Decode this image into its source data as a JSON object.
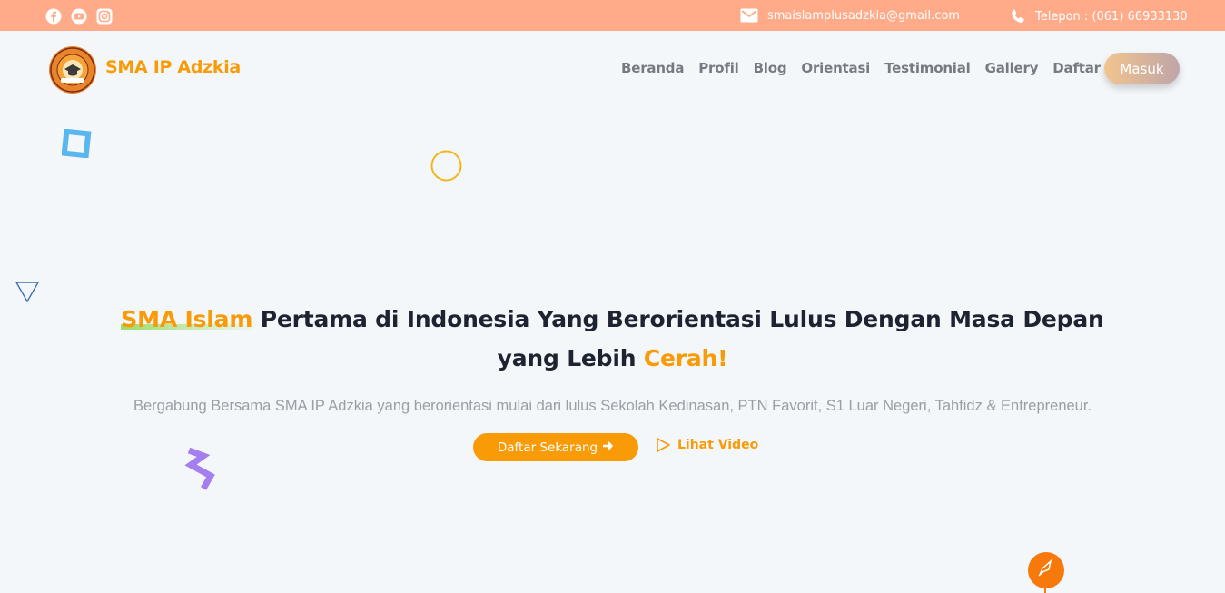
{
  "topbar": {
    "social": [
      {
        "icon": "facebook-icon"
      },
      {
        "icon": "youtube-icon"
      },
      {
        "icon": "instagram-icon"
      }
    ],
    "email": "smaislamplusadzkia@gmail.com",
    "phone": "Telepon : (061) 66933130",
    "bg_color": "#ffab8a"
  },
  "header": {
    "brand": "SMA IP Adzkia",
    "logo_text_top": "SMA ISLAM PLUS ADZKIA",
    "logo_text_bottom": "MEDAN",
    "nav": [
      "Beranda",
      "Profil",
      "Blog",
      "Orientasi",
      "Testimonial",
      "Gallery",
      "Daftar"
    ],
    "login_label": "Masuk"
  },
  "hero": {
    "title_hl1": "SMA Islam",
    "title_mid": " Pertama di Indonesia Yang Berorientasi Lulus Dengan Masa Depan yang Lebih ",
    "title_hl2": "Cerah!",
    "subtitle": "Bergabung Bersama SMA IP Adzkia yang berorientasi mulai dari lulus Sekolah Kedinasan, PTN Favorit, S1 Luar Negeri, Tahfidz & Entrepreneur.",
    "cta_label": "Daftar Sekarang",
    "video_label": "Lihat Video"
  },
  "colors": {
    "accent": "#f99a07",
    "nav_text": "#777a80",
    "title_text": "#1d2330",
    "subtitle_text": "#9a9ea5"
  }
}
